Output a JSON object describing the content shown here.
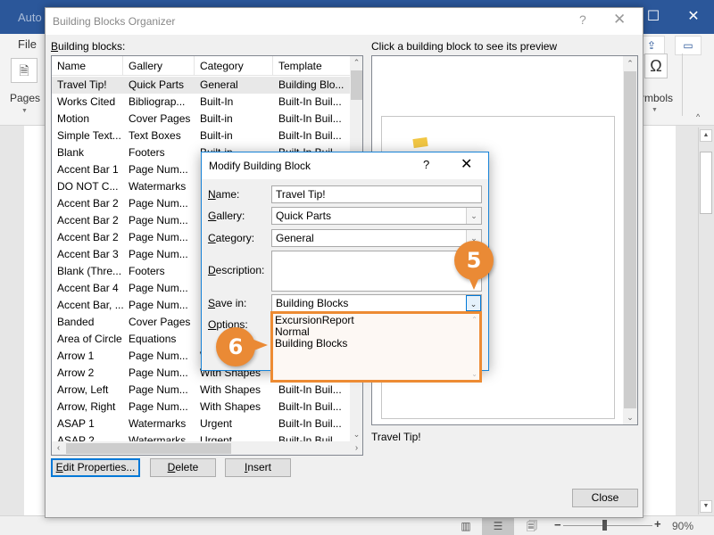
{
  "word": {
    "title_partial": "Auto",
    "file_tab": "File",
    "pages_label": "Pages",
    "symbols_label": "rmbols",
    "omega_glyph": "Ω",
    "zoom_level": "90%",
    "icons": {
      "pages": "page-icon",
      "share": "share-icon",
      "comment": "comment-icon",
      "maximize": "maximize-icon",
      "close": "close-icon",
      "read_mode": "read-mode-icon",
      "print_layout": "print-layout-icon",
      "web_layout": "web-layout-icon"
    }
  },
  "organizer": {
    "title": "Building Blocks Organizer",
    "help": "?",
    "close": "✕",
    "list_label_prefix": "B",
    "list_label_rest": "uilding blocks:",
    "preview_label": "Click a building block to see its preview",
    "preview_caption": "Travel Tip!",
    "columns": [
      "Name",
      "Gallery",
      "Category",
      "Template"
    ],
    "rows": [
      [
        "Travel Tip!",
        "Quick Parts",
        "General",
        "Building Blo..."
      ],
      [
        "Works Cited",
        "Bibliograp...",
        "Built-In",
        "Built-In Buil..."
      ],
      [
        "Motion",
        "Cover Pages",
        "Built-in",
        "Built-In Buil..."
      ],
      [
        " Simple Text...",
        "Text Boxes",
        "Built-in",
        "Built-In Buil..."
      ],
      [
        " Blank",
        "Footers",
        "Built-in",
        "Built-In Buil..."
      ],
      [
        "Accent Bar 1",
        "Page Num...",
        "",
        ""
      ],
      [
        "DO NOT C...",
        "Watermarks",
        "",
        ""
      ],
      [
        "Accent Bar 2",
        "Page Num...",
        "",
        ""
      ],
      [
        "Accent Bar 2",
        "Page Num...",
        "",
        ""
      ],
      [
        "Accent Bar 2",
        "Page Num...",
        "",
        ""
      ],
      [
        "Accent Bar 3",
        "Page Num...",
        "",
        ""
      ],
      [
        " Blank (Thre...",
        "Footers",
        "",
        ""
      ],
      [
        "Accent Bar 4",
        "Page Num...",
        "",
        ""
      ],
      [
        "Accent Bar, ...",
        "Page Num...",
        "",
        ""
      ],
      [
        "Banded",
        "Cover Pages",
        "",
        ""
      ],
      [
        "Area of Circle",
        "Equations",
        "",
        ""
      ],
      [
        "Arrow 1",
        "Page Num...",
        "With Shapes",
        ""
      ],
      [
        "Arrow 2",
        "Page Num...",
        "With Shapes",
        ""
      ],
      [
        "Arrow, Left",
        "Page Num...",
        "With Shapes",
        "Built-In Buil..."
      ],
      [
        "Arrow, Right",
        "Page Num...",
        "With Shapes",
        "Built-In Buil..."
      ],
      [
        "ASAP 1",
        "Watermarks",
        "Urgent",
        "Built-In Buil..."
      ],
      [
        "ASAP 2",
        "Watermarks",
        "Urgent",
        "Built-In Buil..."
      ]
    ],
    "buttons": {
      "edit_prefix": "E",
      "edit_rest": "dit Properties...",
      "delete_prefix": "D",
      "delete_rest": "elete",
      "insert_prefix": "I",
      "insert_rest": "nsert",
      "close": "Close"
    }
  },
  "modify": {
    "title": "Modify Building Block",
    "help": "?",
    "close": "✕",
    "fields": {
      "name_u": "N",
      "name_rest": "ame:",
      "name_value": "Travel Tip!",
      "gallery_u": "G",
      "gallery_rest": "allery:",
      "gallery_value": "Quick Parts",
      "category_u": "C",
      "category_rest": "ategory:",
      "category_value": "General",
      "description_u": "D",
      "description_rest": "escription:",
      "description_value": "",
      "savein_u": "S",
      "savein_rest": "ave in:",
      "savein_value": "Building Blocks",
      "options_u": "O",
      "options_rest": "ptions:"
    },
    "savein_options": [
      "ExcursionReport",
      "Normal",
      "Building Blocks"
    ]
  },
  "callouts": {
    "step5": "5",
    "step6": "6",
    "accent_color": "#ea8a35"
  }
}
